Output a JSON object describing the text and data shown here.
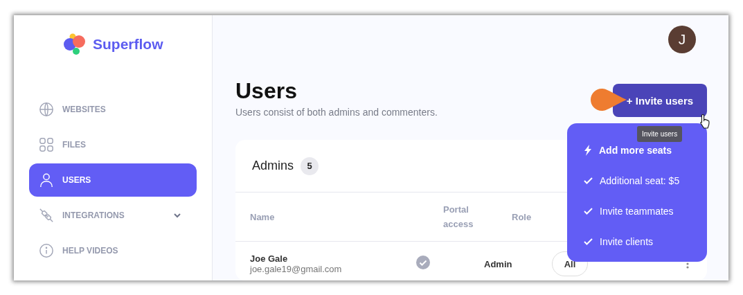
{
  "sidebar": {
    "logo": "Superflow",
    "items": [
      {
        "label": "WEBSITES",
        "kind": "globe",
        "selected": false,
        "expandable": false
      },
      {
        "label": "FILES",
        "kind": "grid",
        "selected": false,
        "expandable": false
      },
      {
        "label": "USERS",
        "kind": "user",
        "selected": true,
        "expandable": false
      },
      {
        "label": "INTEGRATIONS",
        "kind": "plug",
        "selected": false,
        "expandable": true
      },
      {
        "label": "HELP VIDEOS",
        "kind": "info",
        "selected": false,
        "expandable": false
      }
    ]
  },
  "avatar": {
    "initial": "J"
  },
  "page": {
    "title": "Users",
    "subtitle": "Users consist of both admins and commenters."
  },
  "invite_button": {
    "label": "+ Invite users",
    "tooltip": "Invite users"
  },
  "menu": {
    "header": "Add more seats",
    "items": [
      "Additional seat: $5",
      "Invite teammates",
      "Invite clients"
    ]
  },
  "card": {
    "title": "Admins",
    "count": "5",
    "columns": [
      "Name",
      "Portal access",
      "Role"
    ],
    "rows": [
      {
        "name": "Joe Gale",
        "email": "joe.gale19@gmail.com",
        "portal_access": true,
        "role": "Admin",
        "access": "All"
      }
    ]
  }
}
